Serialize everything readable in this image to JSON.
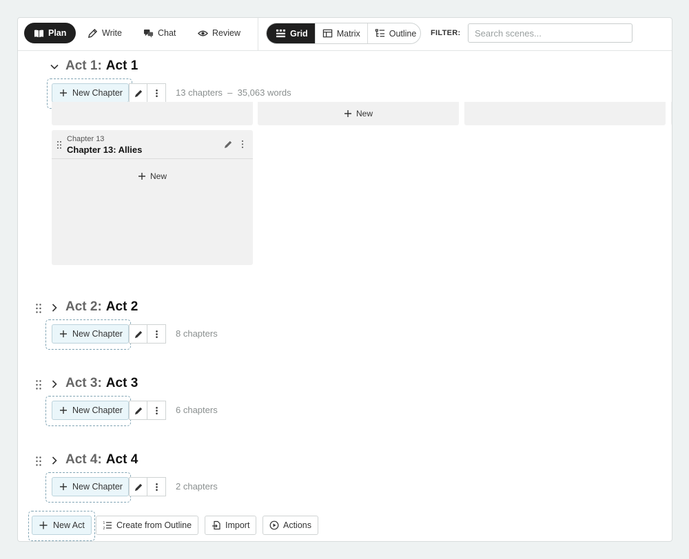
{
  "toolbar": {
    "modes": [
      {
        "label": "Plan",
        "icon": "book-icon",
        "active": true
      },
      {
        "label": "Write",
        "icon": "pencil-icon",
        "active": false
      },
      {
        "label": "Chat",
        "icon": "chat-icon",
        "active": false
      },
      {
        "label": "Review",
        "icon": "eye-icon",
        "active": false
      }
    ],
    "views": [
      {
        "label": "Grid",
        "icon": "grid-icon",
        "active": true
      },
      {
        "label": "Matrix",
        "icon": "table-icon",
        "active": false
      },
      {
        "label": "Outline",
        "icon": "outline-icon",
        "active": false
      }
    ],
    "filter_label": "FILTER:",
    "search_placeholder": "Search scenes..."
  },
  "acts": [
    {
      "prefix": "Act 1:",
      "name": "Act 1",
      "expanded": true,
      "new_chapter_label": "New Chapter",
      "meta": "13 chapters  –  35,063 words"
    },
    {
      "prefix": "Act 2:",
      "name": "Act 2",
      "expanded": false,
      "new_chapter_label": "New Chapter",
      "meta": "8 chapters"
    },
    {
      "prefix": "Act 3:",
      "name": "Act 3",
      "expanded": false,
      "new_chapter_label": "New Chapter",
      "meta": "6 chapters"
    },
    {
      "prefix": "Act 4:",
      "name": "Act 4",
      "expanded": false,
      "new_chapter_label": "New Chapter",
      "meta": "2 chapters"
    }
  ],
  "act1_grid": {
    "strip_new_label": "New",
    "chapter": {
      "number": "Chapter 13",
      "title": "Chapter 13: Allies",
      "new_label": "New"
    }
  },
  "footer": {
    "new_act": "New Act",
    "create_outline": "Create from Outline",
    "import": "Import",
    "actions": "Actions"
  },
  "colors": {
    "accent_dark": "#1f1f1f",
    "new_button_bg": "#eaf6fa",
    "dashed_border": "#7fa3b3"
  }
}
